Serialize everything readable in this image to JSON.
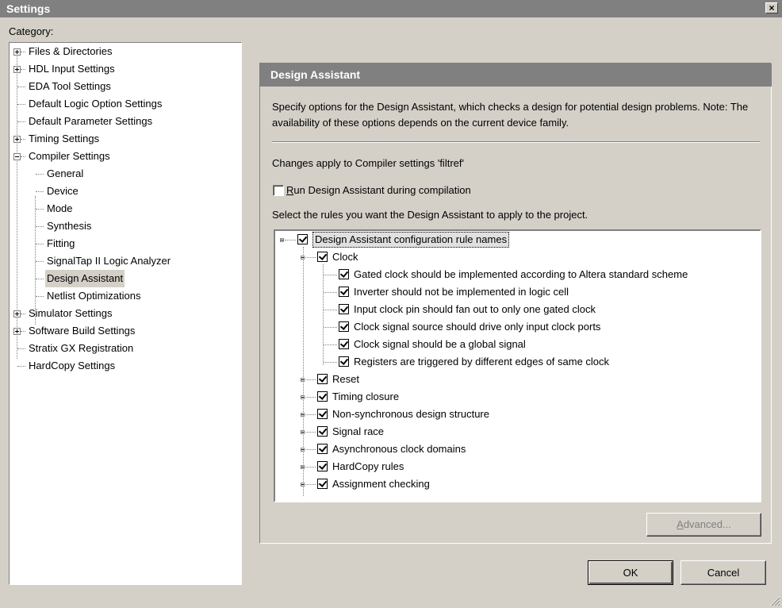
{
  "window": {
    "title": "Settings",
    "close_icon": "close-icon"
  },
  "category": {
    "label": "Category:",
    "items": [
      {
        "label": "Files & Directories"
      },
      {
        "label": "HDL Input Settings"
      },
      {
        "label": "EDA Tool Settings"
      },
      {
        "label": "Default Logic Option Settings"
      },
      {
        "label": "Default Parameter Settings"
      },
      {
        "label": "Timing Settings"
      },
      {
        "label": "Compiler Settings"
      },
      {
        "label": "General"
      },
      {
        "label": "Device"
      },
      {
        "label": "Mode"
      },
      {
        "label": "Synthesis"
      },
      {
        "label": "Fitting"
      },
      {
        "label": "SignalTap II Logic Analyzer"
      },
      {
        "label": "Design Assistant"
      },
      {
        "label": "Netlist Optimizations"
      },
      {
        "label": "Simulator Settings"
      },
      {
        "label": "Software Build Settings"
      },
      {
        "label": "Stratix GX Registration"
      },
      {
        "label": "HardCopy Settings"
      }
    ]
  },
  "panel": {
    "header": "Design Assistant",
    "description": "Specify options for the Design Assistant, which checks a design for potential design problems. Note: The availability of these options depends on the current device family.",
    "changes_text": "Changes apply to Compiler settings 'filtref'",
    "run_checkbox": {
      "label": "Run Design Assistant during compilation",
      "checked": false
    },
    "select_label": "Select the rules you want the Design Assistant to apply to the project.",
    "rules": [
      {
        "label": "Design Assistant configuration rule names",
        "checked": true
      },
      {
        "label": "Clock",
        "checked": true
      },
      {
        "label": "Gated clock should be implemented according to Altera standard scheme",
        "checked": true
      },
      {
        "label": "Inverter should not be implemented in logic cell",
        "checked": true
      },
      {
        "label": "Input clock pin should fan out to only one gated clock",
        "checked": true
      },
      {
        "label": "Clock signal source should drive only input clock ports",
        "checked": true
      },
      {
        "label": "Clock signal should be a global signal",
        "checked": true
      },
      {
        "label": "Registers are triggered by different edges of same clock",
        "checked": true
      },
      {
        "label": "Reset",
        "checked": true
      },
      {
        "label": "Timing closure",
        "checked": true
      },
      {
        "label": "Non-synchronous design structure",
        "checked": true
      },
      {
        "label": "Signal race",
        "checked": true
      },
      {
        "label": "Asynchronous clock domains",
        "checked": true
      },
      {
        "label": "HardCopy rules",
        "checked": true
      },
      {
        "label": "Assignment checking",
        "checked": true
      }
    ],
    "advanced_button": "Advanced..."
  },
  "buttons": {
    "ok": "OK",
    "cancel": "Cancel"
  },
  "colors": {
    "face": "#d4d0c8",
    "header": "#808080",
    "white": "#ffffff"
  }
}
